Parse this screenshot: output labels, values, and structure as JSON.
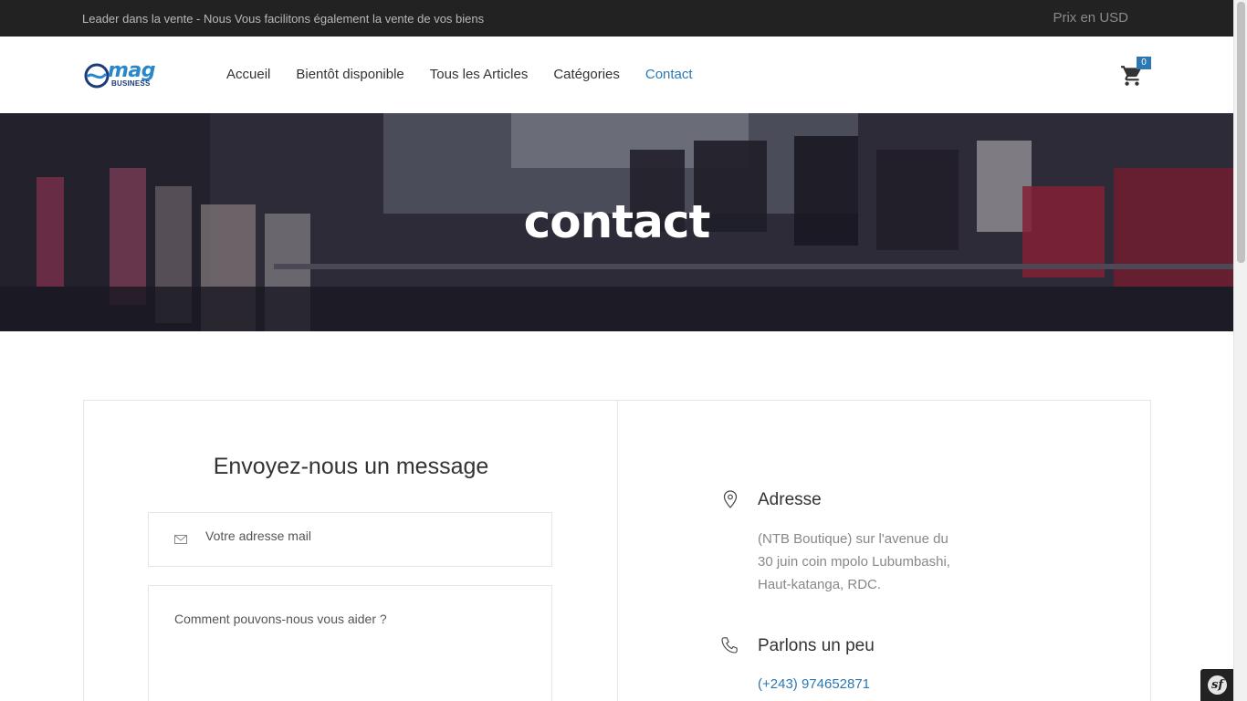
{
  "topbar": {
    "tagline": "Leader dans la vente - Nous Vous facilitons également la vente de vos biens",
    "price_label": "Prix en USD"
  },
  "header": {
    "logo_text": "mag",
    "logo_subtext": "BUSINESS",
    "nav": [
      {
        "label": "Accueil",
        "active": false
      },
      {
        "label": "Bientôt disponible",
        "active": false
      },
      {
        "label": "Tous les Articles",
        "active": false
      },
      {
        "label": "Catégories",
        "active": false
      },
      {
        "label": "Contact",
        "active": true
      }
    ],
    "cart_count": "0"
  },
  "hero": {
    "title": "contact"
  },
  "contact_form": {
    "title": "Envoyez-nous un message",
    "email_placeholder": "Votre adresse mail",
    "message_placeholder": "Comment pouvons-nous vous aider ?"
  },
  "contact_info": {
    "address": {
      "icon": "map-pin-icon",
      "title": "Adresse",
      "lines": [
        "(NTB Boutique) sur l'avenue du",
        "30 juin coin mpolo Lubumbashi,",
        "Haut-katanga, RDC."
      ]
    },
    "phone": {
      "icon": "phone-icon",
      "title": "Parlons un peu",
      "number": "(+243) 974652871"
    }
  },
  "colors": {
    "accent": "#2b78b3",
    "topbar_bg": "#222222",
    "text": "#333333",
    "muted": "#888888"
  },
  "debug_badge": {
    "icon": "symfony-icon",
    "label": "sf"
  }
}
